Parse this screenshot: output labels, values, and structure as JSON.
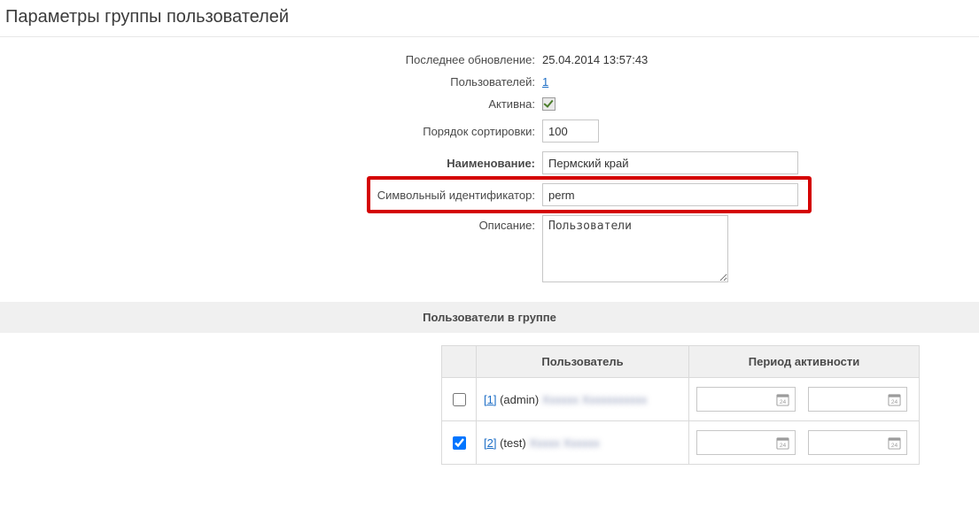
{
  "page": {
    "title": "Параметры группы пользователей"
  },
  "form": {
    "last_update_label": "Последнее обновление:",
    "last_update_value": "25.04.2014 13:57:43",
    "users_count_label": "Пользователей:",
    "users_count_value": "1",
    "active_label": "Активна:",
    "active_checked": true,
    "sort_label": "Порядок сортировки:",
    "sort_value": "100",
    "name_label": "Наименование:",
    "name_value": "Пермский край",
    "symid_label": "Символьный идентификатор:",
    "symid_value": "perm",
    "desc_label": "Описание:",
    "desc_value": "Пользователи "
  },
  "section": {
    "users_in_group": "Пользователи в группе"
  },
  "table": {
    "headers": {
      "user": "Пользователь",
      "period": "Период активности"
    },
    "rows": [
      {
        "checked": false,
        "id_link": "[1]",
        "login": "(admin)",
        "rest": "——"
      },
      {
        "checked": true,
        "id_link": "[2]",
        "login": "(test)",
        "rest": "——"
      }
    ]
  }
}
